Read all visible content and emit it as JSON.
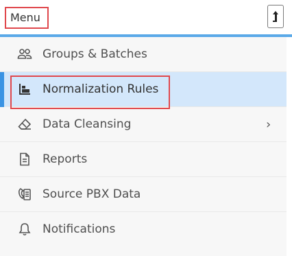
{
  "header": {
    "title": "Menu",
    "collapse_icon": "arrow-up-bar-icon"
  },
  "menu": {
    "items": [
      {
        "label": "Groups & Batches",
        "icon": "users-icon",
        "active": false
      },
      {
        "label": "Normalization Rules",
        "icon": "normalization-icon",
        "active": true
      },
      {
        "label": "Data Cleansing",
        "icon": "eraser-icon",
        "active": false,
        "has_submenu": true
      },
      {
        "label": "Reports",
        "icon": "document-icon",
        "active": false
      },
      {
        "label": "Source PBX Data",
        "icon": "pbx-phone-icon",
        "active": false
      },
      {
        "label": "Notifications",
        "icon": "bell-icon",
        "active": false
      }
    ],
    "submenu_indicator": "›"
  },
  "colors": {
    "accent": "#5aa9e8",
    "active_bg": "#d3e7fb",
    "active_bar": "#3a93e3",
    "highlight": "#e0474c"
  }
}
